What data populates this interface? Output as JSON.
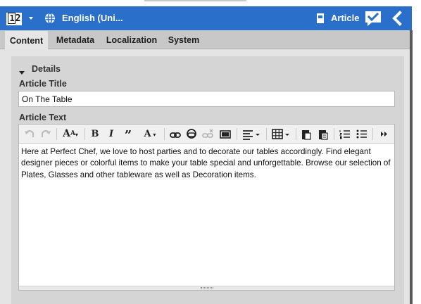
{
  "header": {
    "language": "English (Uni...",
    "view_label": "Article"
  },
  "tabs": [
    {
      "label": "Content",
      "active": true
    },
    {
      "label": "Metadata",
      "active": false
    },
    {
      "label": "Localization",
      "active": false
    },
    {
      "label": "System",
      "active": false
    }
  ],
  "details": {
    "section_label": "Details",
    "title_label": "Article Title",
    "title_value": "On The Table",
    "text_label": "Article Text",
    "text_value": "Here at Perfect Chef, we love to host parties and to decorate our tables accordingly. Find elegant designer pieces or colorful items to make your table special and unforgettable. Browse our selection of Plates, Glasses and other tableware as well as Decoration items."
  },
  "colors": {
    "header_blue": "#2a6fc9",
    "tab_bar": "#c8c8c8",
    "panel": "#d5d5d5"
  },
  "icons": {
    "grid": "grid-layout-icon",
    "globe": "globe-icon",
    "document": "document-icon",
    "check": "check-comment-icon",
    "back": "chevron-left-icon"
  }
}
